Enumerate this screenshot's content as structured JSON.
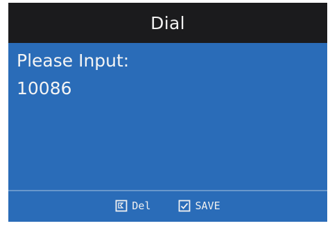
{
  "header": {
    "title": "Dial"
  },
  "main": {
    "prompt": "Please Input:",
    "input_value": "10086"
  },
  "softkeys": {
    "delete_label": "Del",
    "delete_icon": "backspace-icon",
    "save_label": "SAVE",
    "save_icon": "checkbox-icon"
  },
  "colors": {
    "screen_bg": "#2a6cb8",
    "title_bg": "#1b1b1d",
    "text": "#f4f4f4"
  }
}
